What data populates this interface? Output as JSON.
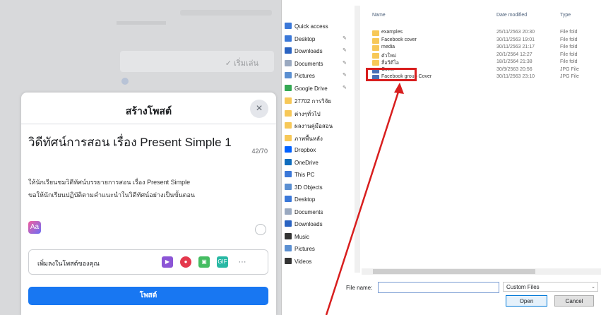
{
  "background": {
    "button_label": "✓ เริ่มเล่น"
  },
  "post_dialog": {
    "title": "สร้างโพสต์",
    "close_glyph": "×",
    "heading": "วิดีทัศน์การสอน เรื่อง Present Simple 1",
    "char_count": "42/70",
    "body_line1": "ให้นักเรียนชมวิดีทัศน์บรรยายการสอน เรื่อง Present Simple",
    "body_line2": "ขอให้นักเรียนปฏิบัติตามคำแนะนำในวิดีทัศน์อย่างเป็นขั้นตอน",
    "aa_label": "Aa",
    "add_to_post": "เพิ่มลงในโพสต์ของคุณ",
    "gif_label": "GIF",
    "more": "···",
    "post_button": "โพสต์"
  },
  "file_dialog": {
    "nav": [
      {
        "label": "Quick access",
        "icon": "star-icon",
        "color": "#3b78d8"
      },
      {
        "label": "Desktop",
        "icon": "desktop-icon",
        "color": "#3b78d8",
        "pin": "✎"
      },
      {
        "label": "Downloads",
        "icon": "download-icon",
        "color": "#2a63c1",
        "pin": "✎"
      },
      {
        "label": "Documents",
        "icon": "document-icon",
        "color": "#9aa9c0",
        "pin": "✎"
      },
      {
        "label": "Pictures",
        "icon": "pictures-icon",
        "color": "#5b8fd1",
        "pin": "✎"
      },
      {
        "label": "Google Drive",
        "icon": "google-drive-icon",
        "color": "#34a853",
        "pin": "✎"
      },
      {
        "label": "27702 การวิจัย",
        "icon": "folder-icon",
        "color": "#f7c858"
      },
      {
        "label": "ต่างๆทั่วไป",
        "icon": "folder-icon",
        "color": "#f7c858"
      },
      {
        "label": "ผลงานคู่มือสอน",
        "icon": "folder-icon",
        "color": "#f7c858"
      },
      {
        "label": "ภาพพื้นหลัง",
        "icon": "folder-icon",
        "color": "#f7c858"
      },
      {
        "label": "Dropbox",
        "icon": "dropbox-icon",
        "color": "#0061ff"
      },
      {
        "label": "OneDrive",
        "icon": "onedrive-icon",
        "color": "#0f6cbd"
      },
      {
        "label": "This PC",
        "icon": "pc-icon",
        "color": "#3b78d8"
      },
      {
        "label": "3D Objects",
        "icon": "cube-icon",
        "color": "#5b8fd1"
      },
      {
        "label": "Desktop",
        "icon": "desktop-icon",
        "color": "#3b78d8"
      },
      {
        "label": "Documents",
        "icon": "document-icon",
        "color": "#9aa9c0"
      },
      {
        "label": "Downloads",
        "icon": "download-icon",
        "color": "#2a63c1"
      },
      {
        "label": "Music",
        "icon": "music-icon",
        "color": "#333333"
      },
      {
        "label": "Pictures",
        "icon": "pictures-icon",
        "color": "#5b8fd1"
      },
      {
        "label": "Videos",
        "icon": "video-icon",
        "color": "#333333"
      }
    ],
    "columns": {
      "name": "Name",
      "date": "Date modified",
      "type": "Type"
    },
    "files": [
      {
        "name": "examples",
        "date": "25/11/2563 20:30",
        "type": "File fold",
        "kind": "folder"
      },
      {
        "name": "Facebook cover",
        "date": "30/11/2563 19:01",
        "type": "File fold",
        "kind": "folder"
      },
      {
        "name": "media",
        "date": "30/11/2563 21:17",
        "type": "File fold",
        "kind": "folder"
      },
      {
        "name": "ตัวใหม่",
        "date": "20/1/2564 12:27",
        "type": "File fold",
        "kind": "folder"
      },
      {
        "name": "สื่อวีดีโอ",
        "date": "18/1/2564 21:38",
        "type": "File fold",
        "kind": "folder"
      },
      {
        "name": "Cover",
        "date": "30/9/2563 20:56",
        "type": "JPG File",
        "kind": "image"
      },
      {
        "name": "Facebook group Cover",
        "date": "30/11/2563 23:10",
        "type": "JPG File",
        "kind": "image"
      }
    ],
    "file_name_label": "File name:",
    "file_name_value": "",
    "file_type": "Custom Files",
    "open_button": "Open",
    "cancel_button": "Cancel"
  },
  "colors": {
    "facebook_blue": "#1877f2",
    "highlight_red": "#d81e1e"
  }
}
